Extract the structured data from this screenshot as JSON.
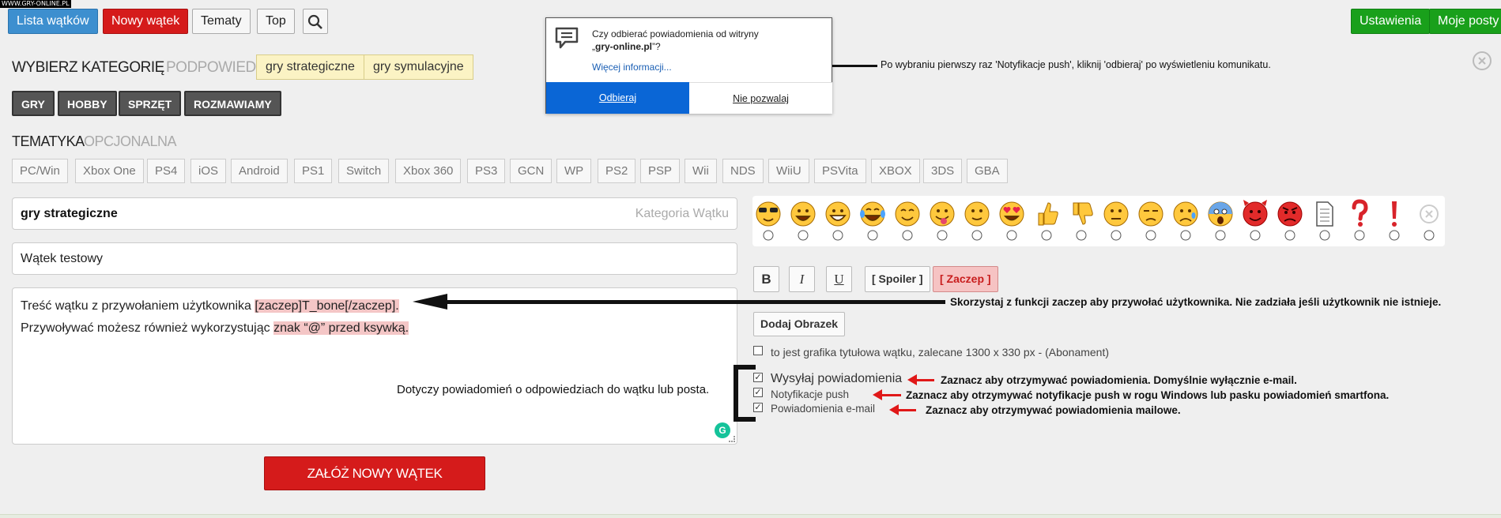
{
  "watermark": "WWW.GRY-ONLINE.PL",
  "topbar": {
    "list_label": "Lista wątków",
    "new_label": "Nowy wątek",
    "topics_label": "Tematy",
    "top_label": "Top",
    "settings_label": "Ustawienia",
    "myposts_label": "Moje posty"
  },
  "category": {
    "title": "WYBIERZ KATEGORIĘ",
    "hints_label": "PODPOWIEDZI:",
    "hints": [
      "gry strategiczne",
      "gry symulacyjne"
    ],
    "buttons": [
      "GRY",
      "HOBBY",
      "SPRZĘT",
      "ROZMAWIAMY"
    ]
  },
  "topic": {
    "title": "TEMATYKA",
    "optional": "OPCJONALNA",
    "platforms": [
      "PC/Win",
      "Xbox One",
      "PS4",
      "iOS",
      "Android",
      "PS1",
      "Switch",
      "Xbox 360",
      "PS3",
      "GCN",
      "WP",
      "PS2",
      "PSP",
      "Wii",
      "NDS",
      "WiiU",
      "PSVita",
      "XBOX",
      "3DS",
      "GBA"
    ]
  },
  "form": {
    "category_value": "gry strategiczne",
    "category_placeholder": "Kategoria Wątku",
    "title_value": "Wątek testowy",
    "body_line1_pre": "Treść wątku z przywołaniem użytkownika ",
    "body_line1_hl": "[zaczep]T_bone[/zaczep].",
    "body_line2_pre": "Przywoływać możesz również wykorzystując ",
    "body_line2_hl": "znak “@” przed ksywką.",
    "submit_label": "ZAŁÓŻ NOWY WĄTEK",
    "grammarly_icon": "G"
  },
  "formatting": {
    "bold": "B",
    "italic": "I",
    "underline": "U",
    "spoiler": "[ Spoiler ]",
    "zaczep": "[ Zaczep ]",
    "add_image": "Dodaj Obrazek"
  },
  "options": {
    "title_graphic": "to jest grafika tytułowa wątku, zalecane 1300 x 330 px - (Abonament)",
    "send_notifications": "Wysyłaj powiadomienia",
    "push_notifications": "Notyfikacje push",
    "email_notifications": "Powiadomienia e-mail"
  },
  "popup": {
    "question_pre": "Czy odbierać powiadomienia od witryny „",
    "question_site": "gry-online.pl",
    "question_post": "”?",
    "more_info": "Więcej informacji...",
    "accept": "Odbieraj",
    "deny": "Nie pozwalaj"
  },
  "annotations": {
    "push_first_time": "Po wybraniu pierwszy raz 'Notyfikacje push', kliknij 'odbieraj' po wyświetleniu komunikatu.",
    "zaczep_note": "Skorzystaj z funkcji zaczep aby przywołać użytkownika. Nie zadziała jeśli użytkownik nie istnieje.",
    "notifications_about": "Dotyczy powiadomień o odpowiedziach do wątku lub posta.",
    "send_note": "Zaznacz aby otrzymywać powiadomienia. Domyślnie wyłącznie e-mail.",
    "push_note": "Zaznacz aby otrzymywać notyfikacje push w rogu Windows lub pasku powiadomień smartfona.",
    "email_note": "Zaznacz aby otrzymywać powiadomienia mailowe."
  },
  "emoji_icons": [
    "cool-face",
    "grin-face",
    "big-grin-face",
    "tears-of-joy-face",
    "smile-face",
    "tongue-face",
    "slight-smile-face",
    "heart-eyes-face",
    "thumbs-up",
    "thumbs-down",
    "neutral-face",
    "unamused-face",
    "sad-face",
    "scream-face",
    "devil-face",
    "angry-face",
    "document",
    "question-mark",
    "exclamation-mark",
    "no-emoji"
  ],
  "colors": {
    "accent_blue": "#3d8fcf",
    "accent_red": "#d51b1b",
    "accent_green": "#19a01b",
    "popup_blue": "#0a66d6",
    "highlight": "#f4c6c6",
    "hint_bg": "#fbf3c4"
  }
}
